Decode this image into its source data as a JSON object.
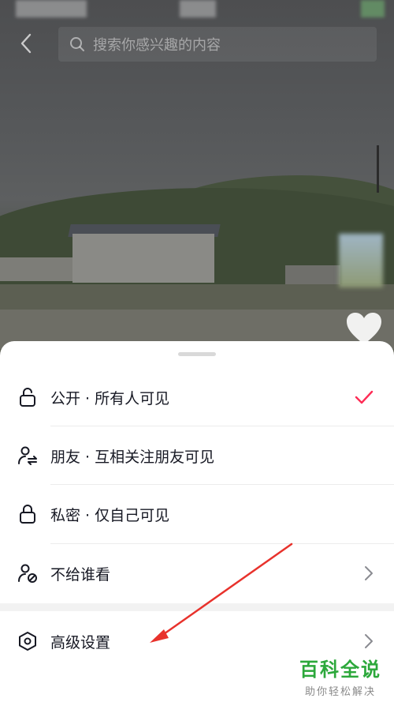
{
  "search": {
    "placeholder": "搜索你感兴趣的内容"
  },
  "privacy_options": [
    {
      "label": "公开 · 所有人可见",
      "icon": "unlock-icon",
      "selected": true
    },
    {
      "label": "朋友 · 互相关注朋友可见",
      "icon": "mutual-friends-icon",
      "selected": false
    },
    {
      "label": "私密 · 仅自己可见",
      "icon": "lock-icon",
      "selected": false
    },
    {
      "label": "不给谁看",
      "icon": "user-blocked-icon",
      "selected": false,
      "has_chevron": true
    }
  ],
  "advanced": {
    "label": "高级设置",
    "icon": "hexagon-settings-icon",
    "has_chevron": true
  },
  "colors": {
    "accent": "#fe2c55",
    "annotation_arrow": "#e8322c",
    "watermark": "#2ca83b"
  },
  "watermark": {
    "title": "百科全说",
    "subtitle": "助你轻松解决"
  }
}
